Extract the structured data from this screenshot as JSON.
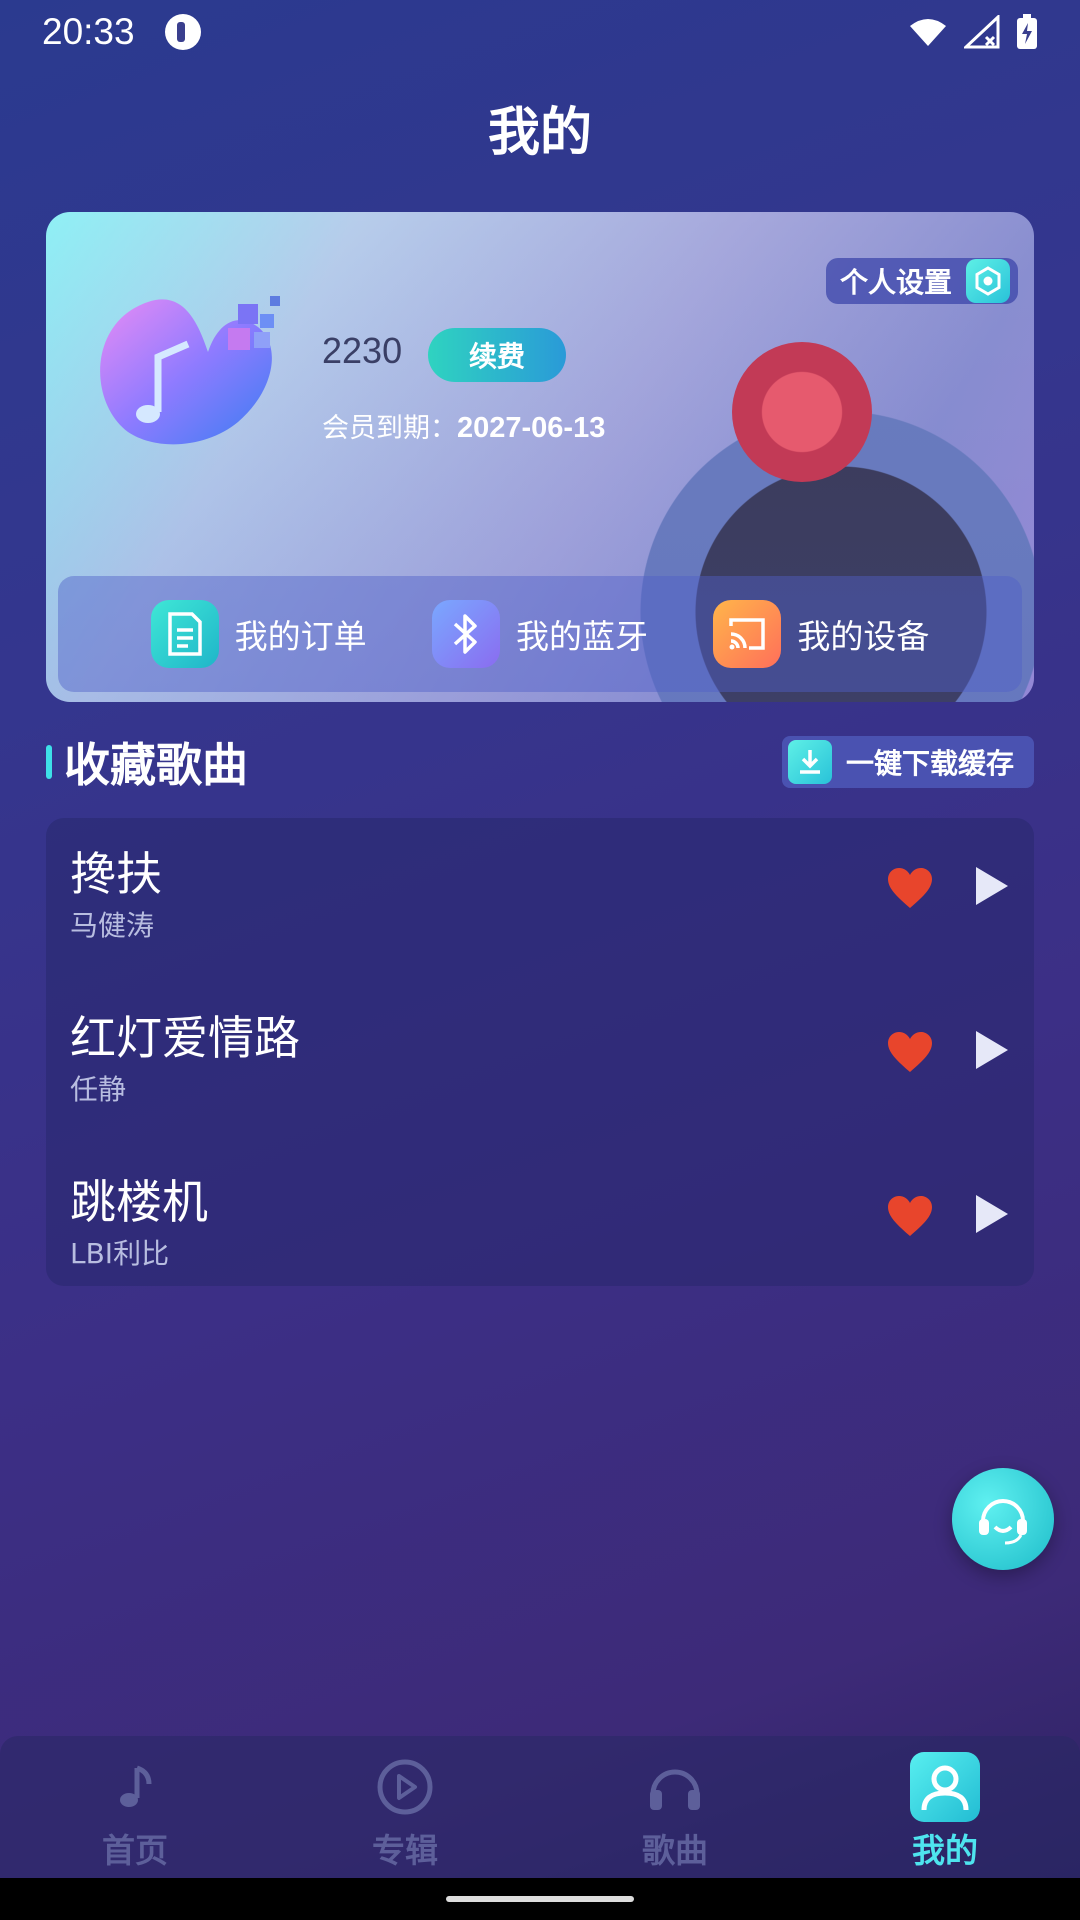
{
  "status_bar": {
    "time": "20:33"
  },
  "header": {
    "title": "我的"
  },
  "profile": {
    "settings_label": "个人设置",
    "username": "2230",
    "renew_label": "续费",
    "expiry_label": "会员到期：",
    "expiry_date": "2027-06-13",
    "quick_links": [
      {
        "label": "我的订单",
        "icon": "document-icon"
      },
      {
        "label": "我的蓝牙",
        "icon": "bluetooth-icon"
      },
      {
        "label": "我的设备",
        "icon": "cast-icon"
      }
    ]
  },
  "favorites": {
    "title": "收藏歌曲",
    "download_label": "一键下载缓存",
    "songs": [
      {
        "title": "搀扶",
        "artist": "马健涛"
      },
      {
        "title": "红灯爱情路",
        "artist": "任静"
      },
      {
        "title": "跳楼机",
        "artist": "LBI利比"
      }
    ]
  },
  "tabs": [
    {
      "label": "首页",
      "icon": "music-note-icon"
    },
    {
      "label": "专辑",
      "icon": "play-circle-icon"
    },
    {
      "label": "歌曲",
      "icon": "headphones-icon"
    },
    {
      "label": "我的",
      "icon": "user-icon",
      "active": true
    }
  ],
  "colors": {
    "accent": "#3ee0e8",
    "heart": "#e8452c"
  }
}
